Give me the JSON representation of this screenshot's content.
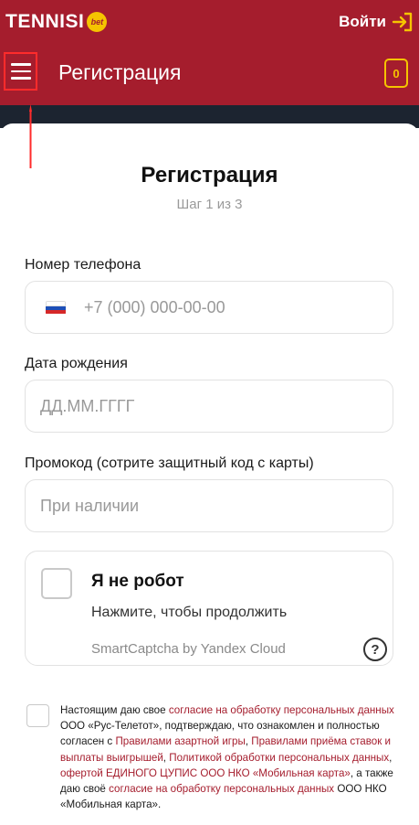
{
  "header": {
    "brand": "TENNISI",
    "brand_badge": "bet",
    "login_label": "Войти",
    "title": "Регистрация",
    "ticket_count": "0"
  },
  "form": {
    "title": "Регистрация",
    "step": "Шаг 1 из 3",
    "phone_label": "Номер телефона",
    "phone_placeholder": "+7 (000) 000-00-00",
    "birth_label": "Дата рождения",
    "birth_placeholder": "ДД.ММ.ГГГГ",
    "promo_label": "Промокод (сотрите защитный код с карты)",
    "promo_placeholder": "При наличии"
  },
  "captcha": {
    "title": "Я не робот",
    "subtitle": "Нажмите, чтобы продолжить",
    "brand": "SmartCaptcha by Yandex Cloud",
    "help": "?"
  },
  "consent": {
    "t1": "Настоящим даю свое ",
    "l1": "согласие на обработку персональных данных",
    "t2": " ООО «Рус-Телетот», подтверждаю, что ознакомлен и полностью согласен с ",
    "l2": "Правилами азартной игры",
    "t3": ", ",
    "l3": "Правилами приёма ставок и выплаты выигрышей",
    "t4": ", ",
    "l4": "Политикой обработки персональных данных",
    "t5": ", ",
    "l5": "офертой ЕДИНОГО ЦУПИС ООО НКО «Мобильная карта»",
    "t6": ", а также даю своё ",
    "l6": "согласие на обработку персональных данных",
    "t7": " ООО НКО «Мобильная карта»."
  },
  "colors": {
    "brand_red": "#a51d2d",
    "accent_yellow": "#f5c400",
    "annotation_red": "#ff2b2b"
  }
}
